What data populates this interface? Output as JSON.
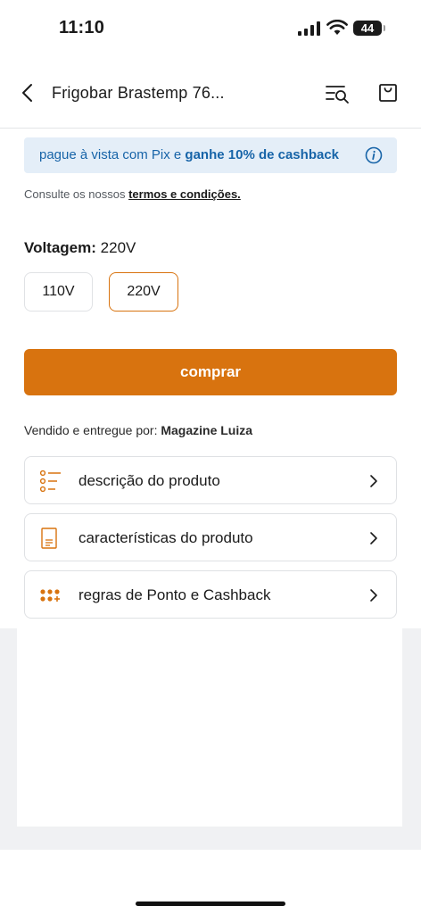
{
  "status_bar": {
    "time": "11:10",
    "battery": "44"
  },
  "header": {
    "title": "Frigobar Brastemp 76..."
  },
  "pix_banner": {
    "text_prefix": "pague à vista com Pix e ",
    "text_bold": "ganhe 10% de cashback"
  },
  "terms": {
    "prefix": "Consulte os nossos ",
    "link": "termos e condições."
  },
  "voltage": {
    "label": "Voltagem:",
    "selected_value": "220V",
    "options": [
      "110V",
      "220V"
    ]
  },
  "buy_button": {
    "label": "comprar"
  },
  "seller": {
    "prefix": "Vendido e entregue por: ",
    "name": "Magazine Luiza"
  },
  "menu": {
    "items": [
      {
        "label": "descrição do produto",
        "icon": "list-icon"
      },
      {
        "label": "características do produto",
        "icon": "document-icon"
      },
      {
        "label": "regras de Ponto e Cashback",
        "icon": "dots-grid-icon"
      }
    ]
  },
  "colors": {
    "accent": "#d8730f",
    "pix_text": "#1764a8",
    "pix_bg": "#e4eef8"
  }
}
